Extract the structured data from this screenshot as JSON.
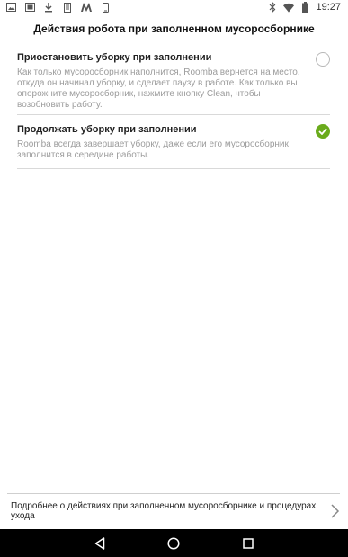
{
  "status_bar": {
    "left_icons": [
      "image-icon",
      "gallery-icon",
      "download-icon",
      "document-icon",
      "m-logo-icon",
      "mobile-icon"
    ],
    "right_icons": [
      "bluetooth-icon",
      "wifi-icon",
      "battery-icon"
    ],
    "time": "19:27"
  },
  "page": {
    "title": "Действия робота при заполненном мусоросборнике"
  },
  "options": [
    {
      "title": "Приостановить уборку при заполнении",
      "description": "Как только мусоросборник наполнится, Roomba вернется на место, откуда он начинал уборку, и сделает паузу в работе. Как только вы опорожните мусоросборник, нажмите кнопку Clean, чтобы возобновить работу.",
      "selected": false
    },
    {
      "title": "Продолжать уборку при заполнении",
      "description": "Roomba всегда завершает уборку, даже если его мусоросборник заполнится в середине работы.",
      "selected": true
    }
  ],
  "footer": {
    "link_text": "Подробнее о действиях при заполненном мусоросборнике и процедурах ухода"
  },
  "colors": {
    "accent_green": "#6aab1c",
    "nav_bar": "#000000"
  },
  "navigation": {
    "icons": [
      "back-icon",
      "home-icon",
      "recents-icon"
    ]
  }
}
